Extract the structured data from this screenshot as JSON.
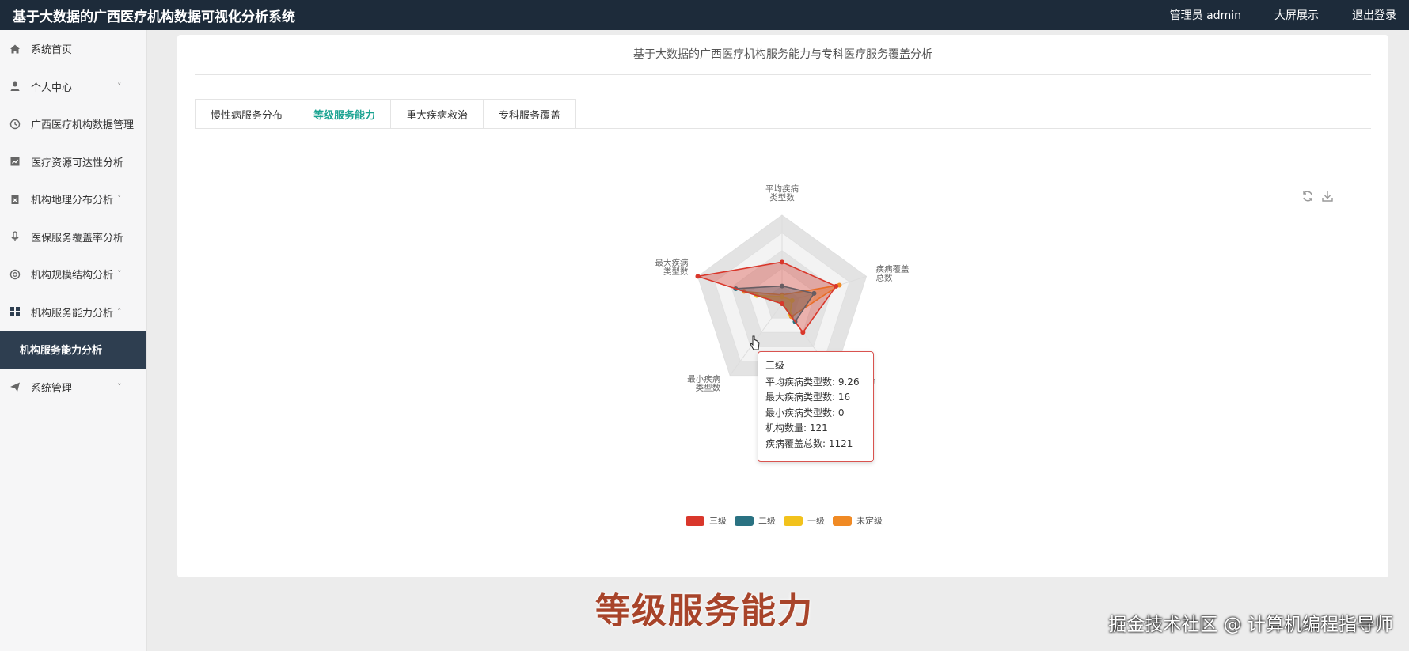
{
  "app": {
    "title": "基于大数据的广西医疗机构数据可视化分析系统"
  },
  "header": {
    "links": [
      {
        "label": "管理员 admin"
      },
      {
        "label": "大屏展示"
      },
      {
        "label": "退出登录"
      }
    ]
  },
  "sidebar": {
    "items": [
      {
        "label": "系统首页",
        "icon": "home-icon",
        "chevron": ""
      },
      {
        "label": "个人中心",
        "icon": "user-icon",
        "chevron": "˅"
      },
      {
        "label": "广西医疗机构数据管理",
        "icon": "clock-icon",
        "chevron": ""
      },
      {
        "label": "医疗资源可达性分析",
        "icon": "chart-icon",
        "chevron": ""
      },
      {
        "label": "机构地理分布分析",
        "icon": "clipboard-icon",
        "chevron": "˅"
      },
      {
        "label": "医保服务覆盖率分析",
        "icon": "microphone-icon",
        "chevron": ""
      },
      {
        "label": "机构规模结构分析",
        "icon": "lifebuoy-icon",
        "chevron": "˅"
      },
      {
        "label": "机构服务能力分析",
        "icon": "grid-icon",
        "chevron": "˄"
      },
      {
        "label": "机构服务能力分析",
        "icon": "",
        "chevron": "",
        "sub": true
      },
      {
        "label": "系统管理",
        "icon": "send-icon",
        "chevron": "˅"
      }
    ]
  },
  "main": {
    "title": "基于大数据的广西医疗机构服务能力与专科医疗服务覆盖分析",
    "tabs": [
      {
        "label": "慢性病服务分布"
      },
      {
        "label": "等级服务能力",
        "active": true
      },
      {
        "label": "重大疾病救治"
      },
      {
        "label": "专科服务覆盖"
      }
    ],
    "toolbox": {
      "refresh_icon": "refresh-icon",
      "download_icon": "download-icon"
    }
  },
  "chart_data": {
    "type": "radar",
    "indicators": [
      {
        "name_lines": [
          "平均疾病",
          "类型数"
        ]
      },
      {
        "name_lines": [
          "疾病覆盖",
          "总数"
        ]
      },
      {
        "name_lines": [
          "机构数量",
          "(对数)"
        ]
      },
      {
        "name_lines": [
          "最小疾病",
          "类型数"
        ]
      },
      {
        "name_lines": [
          "最大疾病",
          "类型数"
        ]
      }
    ],
    "series": [
      {
        "name": "三级",
        "color": "#d9372b",
        "values": [
          0.47,
          0.64,
          0.4,
          0.0,
          1.0
        ]
      },
      {
        "name": "二级",
        "color": "#2a7282",
        "values": [
          0.2,
          0.38,
          0.25,
          0.0,
          0.55
        ]
      },
      {
        "name": "一级",
        "color": "#f2c21c",
        "values": [
          0.08,
          0.12,
          0.15,
          0.0,
          0.3
        ]
      },
      {
        "name": "未定级",
        "color": "#f08a24",
        "values": [
          0.1,
          0.68,
          0.18,
          0.0,
          0.45
        ]
      }
    ],
    "tooltip": {
      "title": "三级",
      "lines": [
        "平均疾病类型数: 9.26",
        "最大疾病类型数: 16",
        "最小疾病类型数: 0",
        "机构数量: 121",
        "疾病覆盖总数: 1121"
      ]
    }
  },
  "caption": "等级服务能力",
  "watermark": "掘金技术社区 @ 计算机编程指导师"
}
